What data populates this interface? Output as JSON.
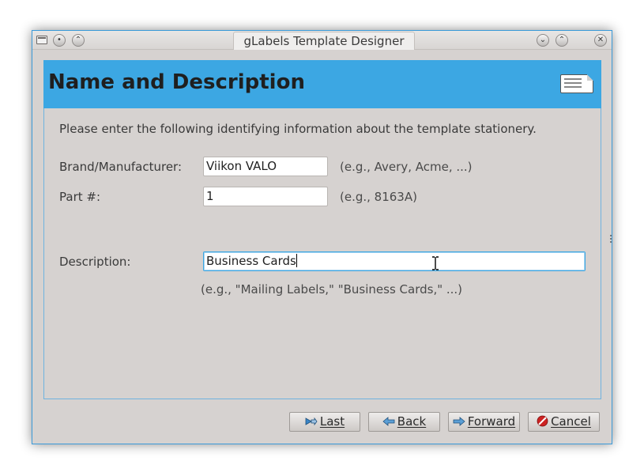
{
  "window": {
    "title": "gLabels Template Designer"
  },
  "header": {
    "title": "Name and Description",
    "icon": "label-sheet-icon"
  },
  "intro_text": "Please enter the following identifying information about the template stationery.",
  "form": {
    "brand": {
      "label": "Brand/Manufacturer:",
      "value": "Viikon VALO",
      "hint": "(e.g., Avery, Acme, ...)"
    },
    "part": {
      "label": "Part #:",
      "value": "1",
      "hint": "(e.g., 8163A)"
    },
    "description": {
      "label": "Description:",
      "value": "Business Cards",
      "hint": "(e.g., \"Mailing Labels,\" \"Business Cards,\" ...)"
    }
  },
  "buttons": {
    "last": "Last",
    "back": "Back",
    "forward": "Forward",
    "cancel": "Cancel"
  },
  "colors": {
    "accent": "#3ca7e3",
    "window_bg": "#d6d2d0",
    "cancel_icon": "#cc2222"
  }
}
